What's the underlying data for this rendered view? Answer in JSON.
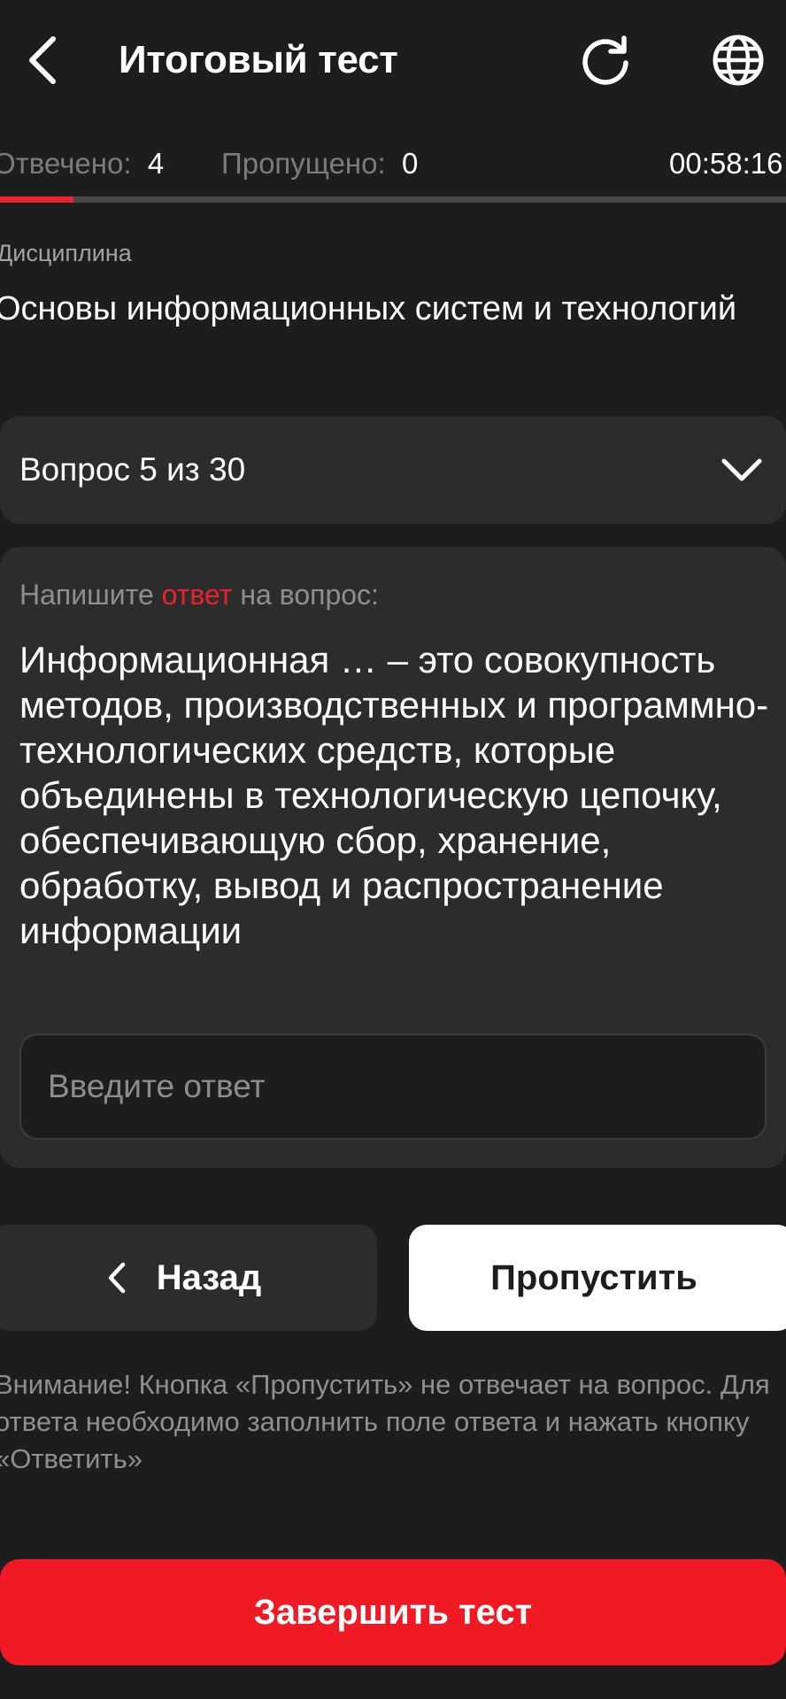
{
  "header": {
    "title": "Итоговый тест",
    "back_icon": "chevron-left-icon",
    "refresh_icon": "refresh-icon",
    "language_icon": "globe-icon"
  },
  "stats": {
    "answered_label": "Отвечено:",
    "answered_value": "4",
    "skipped_label": "Пропущено:",
    "skipped_value": "0",
    "timer": "00:58:16",
    "progress_fraction": 0.093
  },
  "discipline": {
    "label": "Дисциплина",
    "name": "Основы информационных систем и технологий"
  },
  "question_selector": {
    "label": "Вопрос 5 из 30",
    "icon": "chevron-down-icon"
  },
  "question": {
    "instruction_prefix": "Напишите ",
    "instruction_accent": "ответ",
    "instruction_suffix": " на вопрос:",
    "text": "Информационная … – это совокупность методов, производственных и программно-технологических средств, которые объединены в технологическую цепочку, обеспечивающую сбор, хранение, обработку, вывод и распространение информации",
    "answer_value": "",
    "answer_placeholder": "Введите ответ"
  },
  "navigation": {
    "back_label": "Назад",
    "skip_label": "Пропустить"
  },
  "warning": "Внимание! Кнопка «Пропустить» не отвечает на вопрос. Для ответа необходимо заполнить поле ответа и нажать кнопку «Ответить»",
  "finish_label": "Завершить тест",
  "colors": {
    "background": "#1d1d1d",
    "card": "#2c2c2c",
    "accent": "#e8232c",
    "finish": "#ef1a23",
    "muted_text": "#8f8f8f"
  }
}
